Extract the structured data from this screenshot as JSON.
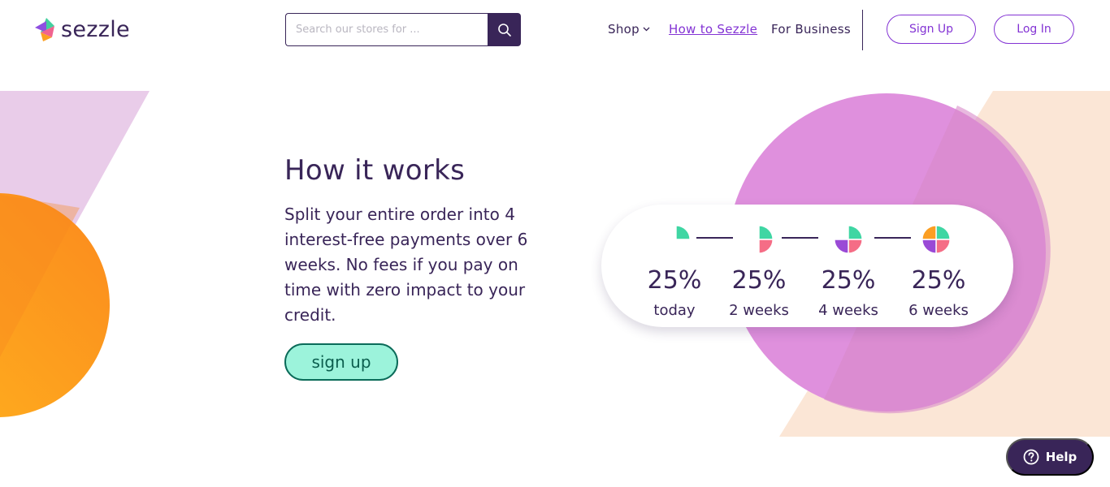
{
  "brand": {
    "name": "sezzle",
    "primary_color": "#392558",
    "accent_color": "#8333d4",
    "mint_color": "#9cf3db",
    "orange_color": "#fb9a1f",
    "pink_color": "#dd8edc"
  },
  "header": {
    "search": {
      "placeholder": "Search our stores for ...",
      "value": "",
      "icon": "search-icon"
    },
    "nav": {
      "shop": "Shop",
      "how": "How to Sezzle",
      "business": "For Business"
    },
    "signup_label": "Sign Up",
    "login_label": "Log In"
  },
  "hero": {
    "title": "How it works",
    "body": "Split your entire order into 4 interest-free payments over 6 weeks. No fees if you pay on time with zero impact to your credit.",
    "cta_label": "sign up"
  },
  "payments": [
    {
      "percent": "25%",
      "when": "today",
      "slices_filled": 1
    },
    {
      "percent": "25%",
      "when": "2 weeks",
      "slices_filled": 2
    },
    {
      "percent": "25%",
      "when": "4 weeks",
      "slices_filled": 3
    },
    {
      "percent": "25%",
      "when": "6 weeks",
      "slices_filled": 4
    }
  ],
  "help": {
    "label": "Help",
    "icon": "question-icon"
  }
}
